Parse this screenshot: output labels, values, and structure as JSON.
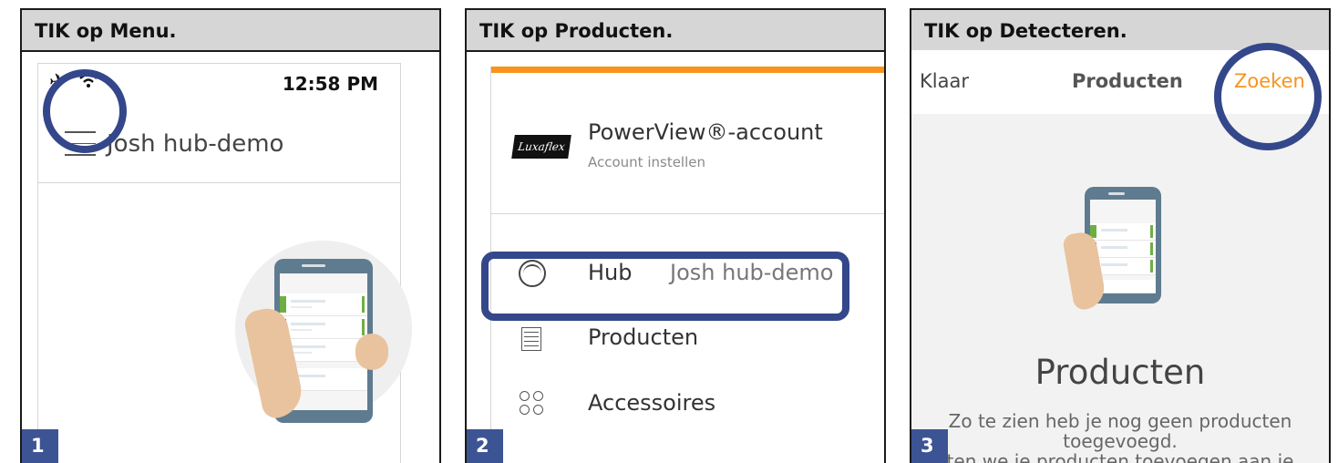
{
  "panels": [
    {
      "step_number": "1",
      "instruction": "TIK op Menu.",
      "status_bar": {
        "time": "12:58 PM"
      },
      "hub_name": "Josh hub-demo"
    },
    {
      "step_number": "2",
      "instruction": "TIK op Producten.",
      "account": {
        "title": "PowerView®-account",
        "subtitle": "Account instellen",
        "logo_text": "Luxaflex"
      },
      "menu_items": [
        {
          "label": "Hub",
          "value": "Josh hub-demo",
          "icon": "hub-icon"
        },
        {
          "label": "Producten",
          "icon": "products-icon"
        },
        {
          "label": "Accessoires",
          "icon": "accessories-icon"
        }
      ]
    },
    {
      "step_number": "3",
      "instruction": "TIK op Detecteren.",
      "nav": {
        "left": "Klaar",
        "title": "Producten",
        "right": "Zoeken"
      },
      "empty_state": {
        "title": "Producten",
        "message": "Zo te zien heb je nog geen producten toegevoegd.",
        "message_cut": "ten we je producten toevoegen aan je"
      }
    }
  ],
  "colors": {
    "accent_blue": "#34478a",
    "orange": "#f7941d",
    "header_gray": "#d6d6d6"
  }
}
